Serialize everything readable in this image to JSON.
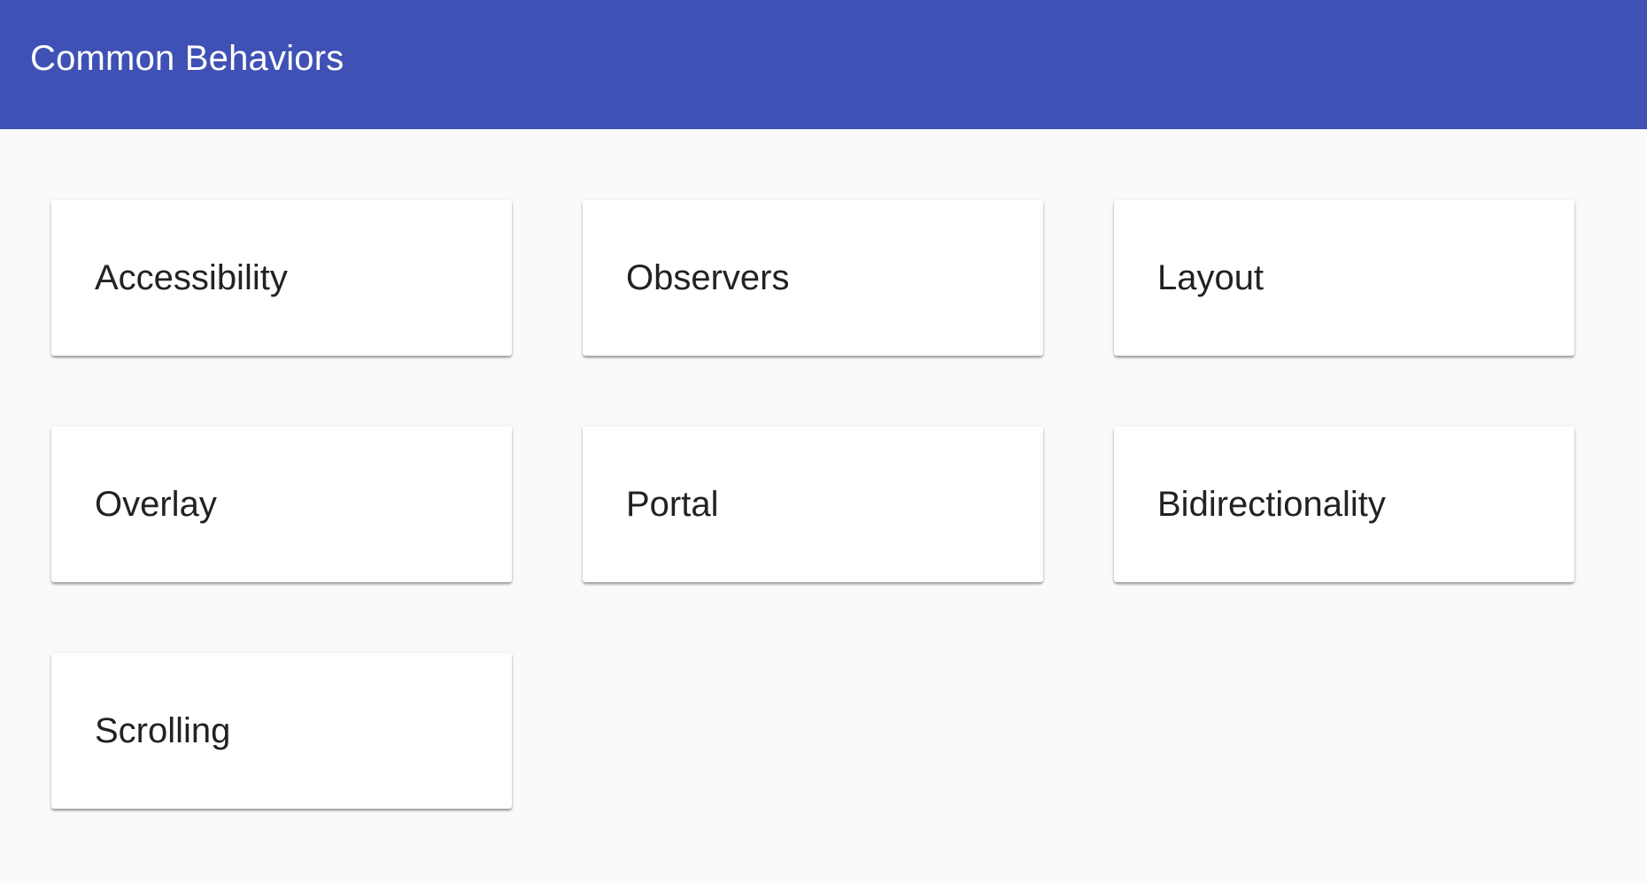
{
  "toolbar": {
    "title": "Common Behaviors",
    "color": "#3f51b5"
  },
  "cards": [
    {
      "label": "Accessibility"
    },
    {
      "label": "Observers"
    },
    {
      "label": "Layout"
    },
    {
      "label": "Overlay"
    },
    {
      "label": "Portal"
    },
    {
      "label": "Bidirectionality"
    },
    {
      "label": "Scrolling"
    }
  ]
}
